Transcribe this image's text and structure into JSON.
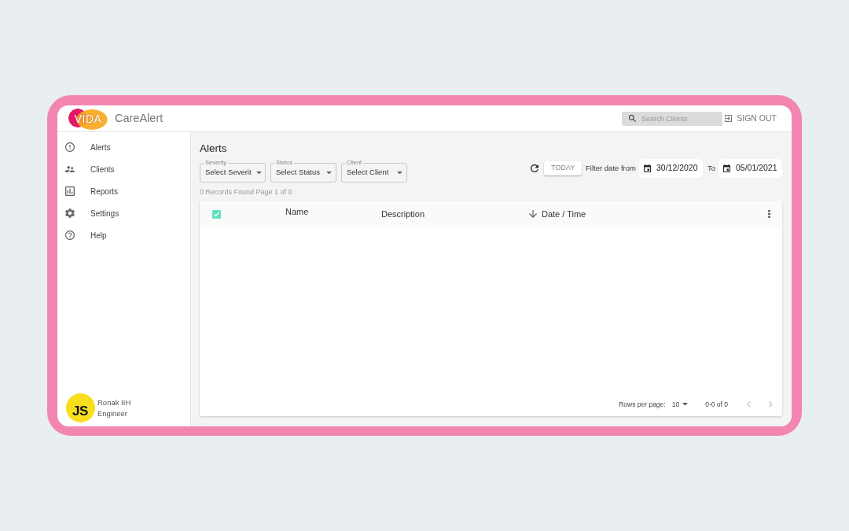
{
  "header": {
    "logo_text": "VIDA",
    "app_name": "CareAlert",
    "search": {
      "placeholder": "Search Clients"
    },
    "sign_out_label": "SIGN OUT"
  },
  "sidebar": {
    "items": [
      {
        "label": "Alerts"
      },
      {
        "label": "Clients"
      },
      {
        "label": "Reports"
      },
      {
        "label": "Settings"
      },
      {
        "label": "Help"
      }
    ],
    "user": {
      "initials": "JS",
      "name": "Ronak IIH",
      "role": "Engineer"
    }
  },
  "main": {
    "title": "Alerts",
    "filters": [
      {
        "label": "Severity",
        "value": "Select Severit"
      },
      {
        "label": "Status",
        "value": "Select Status"
      },
      {
        "label": "Client",
        "value": "Select Client"
      }
    ],
    "records_summary": "0 Records Found Page 1 of 0",
    "date_filter": {
      "today_label": "TODAY",
      "from_label": "Filter date from",
      "from_date": "30/12/2020",
      "to_label": "To",
      "to_date": "05/01/2021"
    },
    "table": {
      "select_all_checked": true,
      "columns": [
        {
          "label": "Name",
          "sorted": false
        },
        {
          "label": "Description",
          "sorted": false
        },
        {
          "label": "Date / Time",
          "sorted": true
        }
      ],
      "pagination": {
        "rows_per_page_label": "Rows per page:",
        "rows_per_page": "10",
        "range": "0-0 of 0",
        "previous_disabled": true,
        "next_disabled": true
      }
    }
  }
}
